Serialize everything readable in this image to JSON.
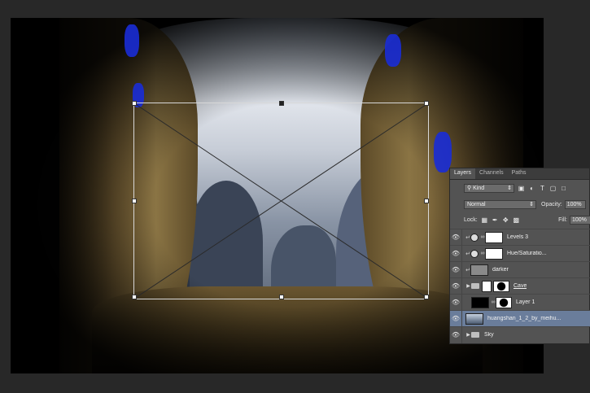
{
  "canvas": {
    "description_colors": {
      "sky": "#c7cdd7",
      "rock": "#6b5630"
    }
  },
  "layers_panel": {
    "tabs": [
      {
        "label": "Layers",
        "active": true
      },
      {
        "label": "Channels",
        "active": false
      },
      {
        "label": "Paths",
        "active": false
      }
    ],
    "filter_kind": "Kind",
    "blend_mode": "Normal",
    "opacity_label": "Opacity:",
    "opacity_value": "100%",
    "lock_label": "Lock:",
    "fill_label": "Fill:",
    "fill_value": "100%",
    "layers": [
      {
        "name": "Levels 3",
        "type": "adjustment",
        "icon": "levels-icon",
        "selected": false
      },
      {
        "name": "Hue/Saturatio...",
        "type": "adjustment",
        "icon": "hue-saturation-icon",
        "selected": false
      },
      {
        "name": "darker",
        "type": "pixel",
        "selected": false
      },
      {
        "name": "Cave",
        "type": "group",
        "selected": false
      },
      {
        "name": "Layer 1",
        "type": "pixel-mask",
        "selected": false
      },
      {
        "name": "huangshan_1_2_by_meihu...",
        "type": "smart-object",
        "selected": true
      },
      {
        "name": "Sky",
        "type": "group",
        "selected": false
      }
    ]
  }
}
